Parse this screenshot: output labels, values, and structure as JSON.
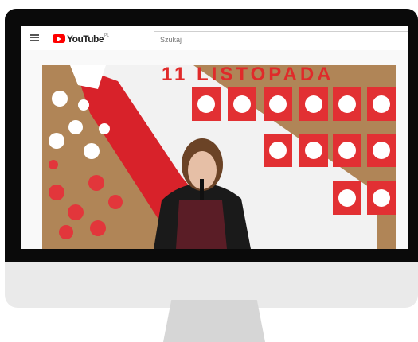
{
  "header": {
    "logo_text": "YouTube",
    "logo_region": "PL",
    "menu_icon": "hamburger-menu-icon"
  },
  "search": {
    "placeholder": "Szukaj"
  },
  "video": {
    "banner_text": "11 LISTOPADA"
  },
  "colors": {
    "youtube_red": "#ff0000",
    "monitor_bezel": "#0a0a0a",
    "monitor_chin": "#eaeaea",
    "stand": "#d6d6d6"
  }
}
